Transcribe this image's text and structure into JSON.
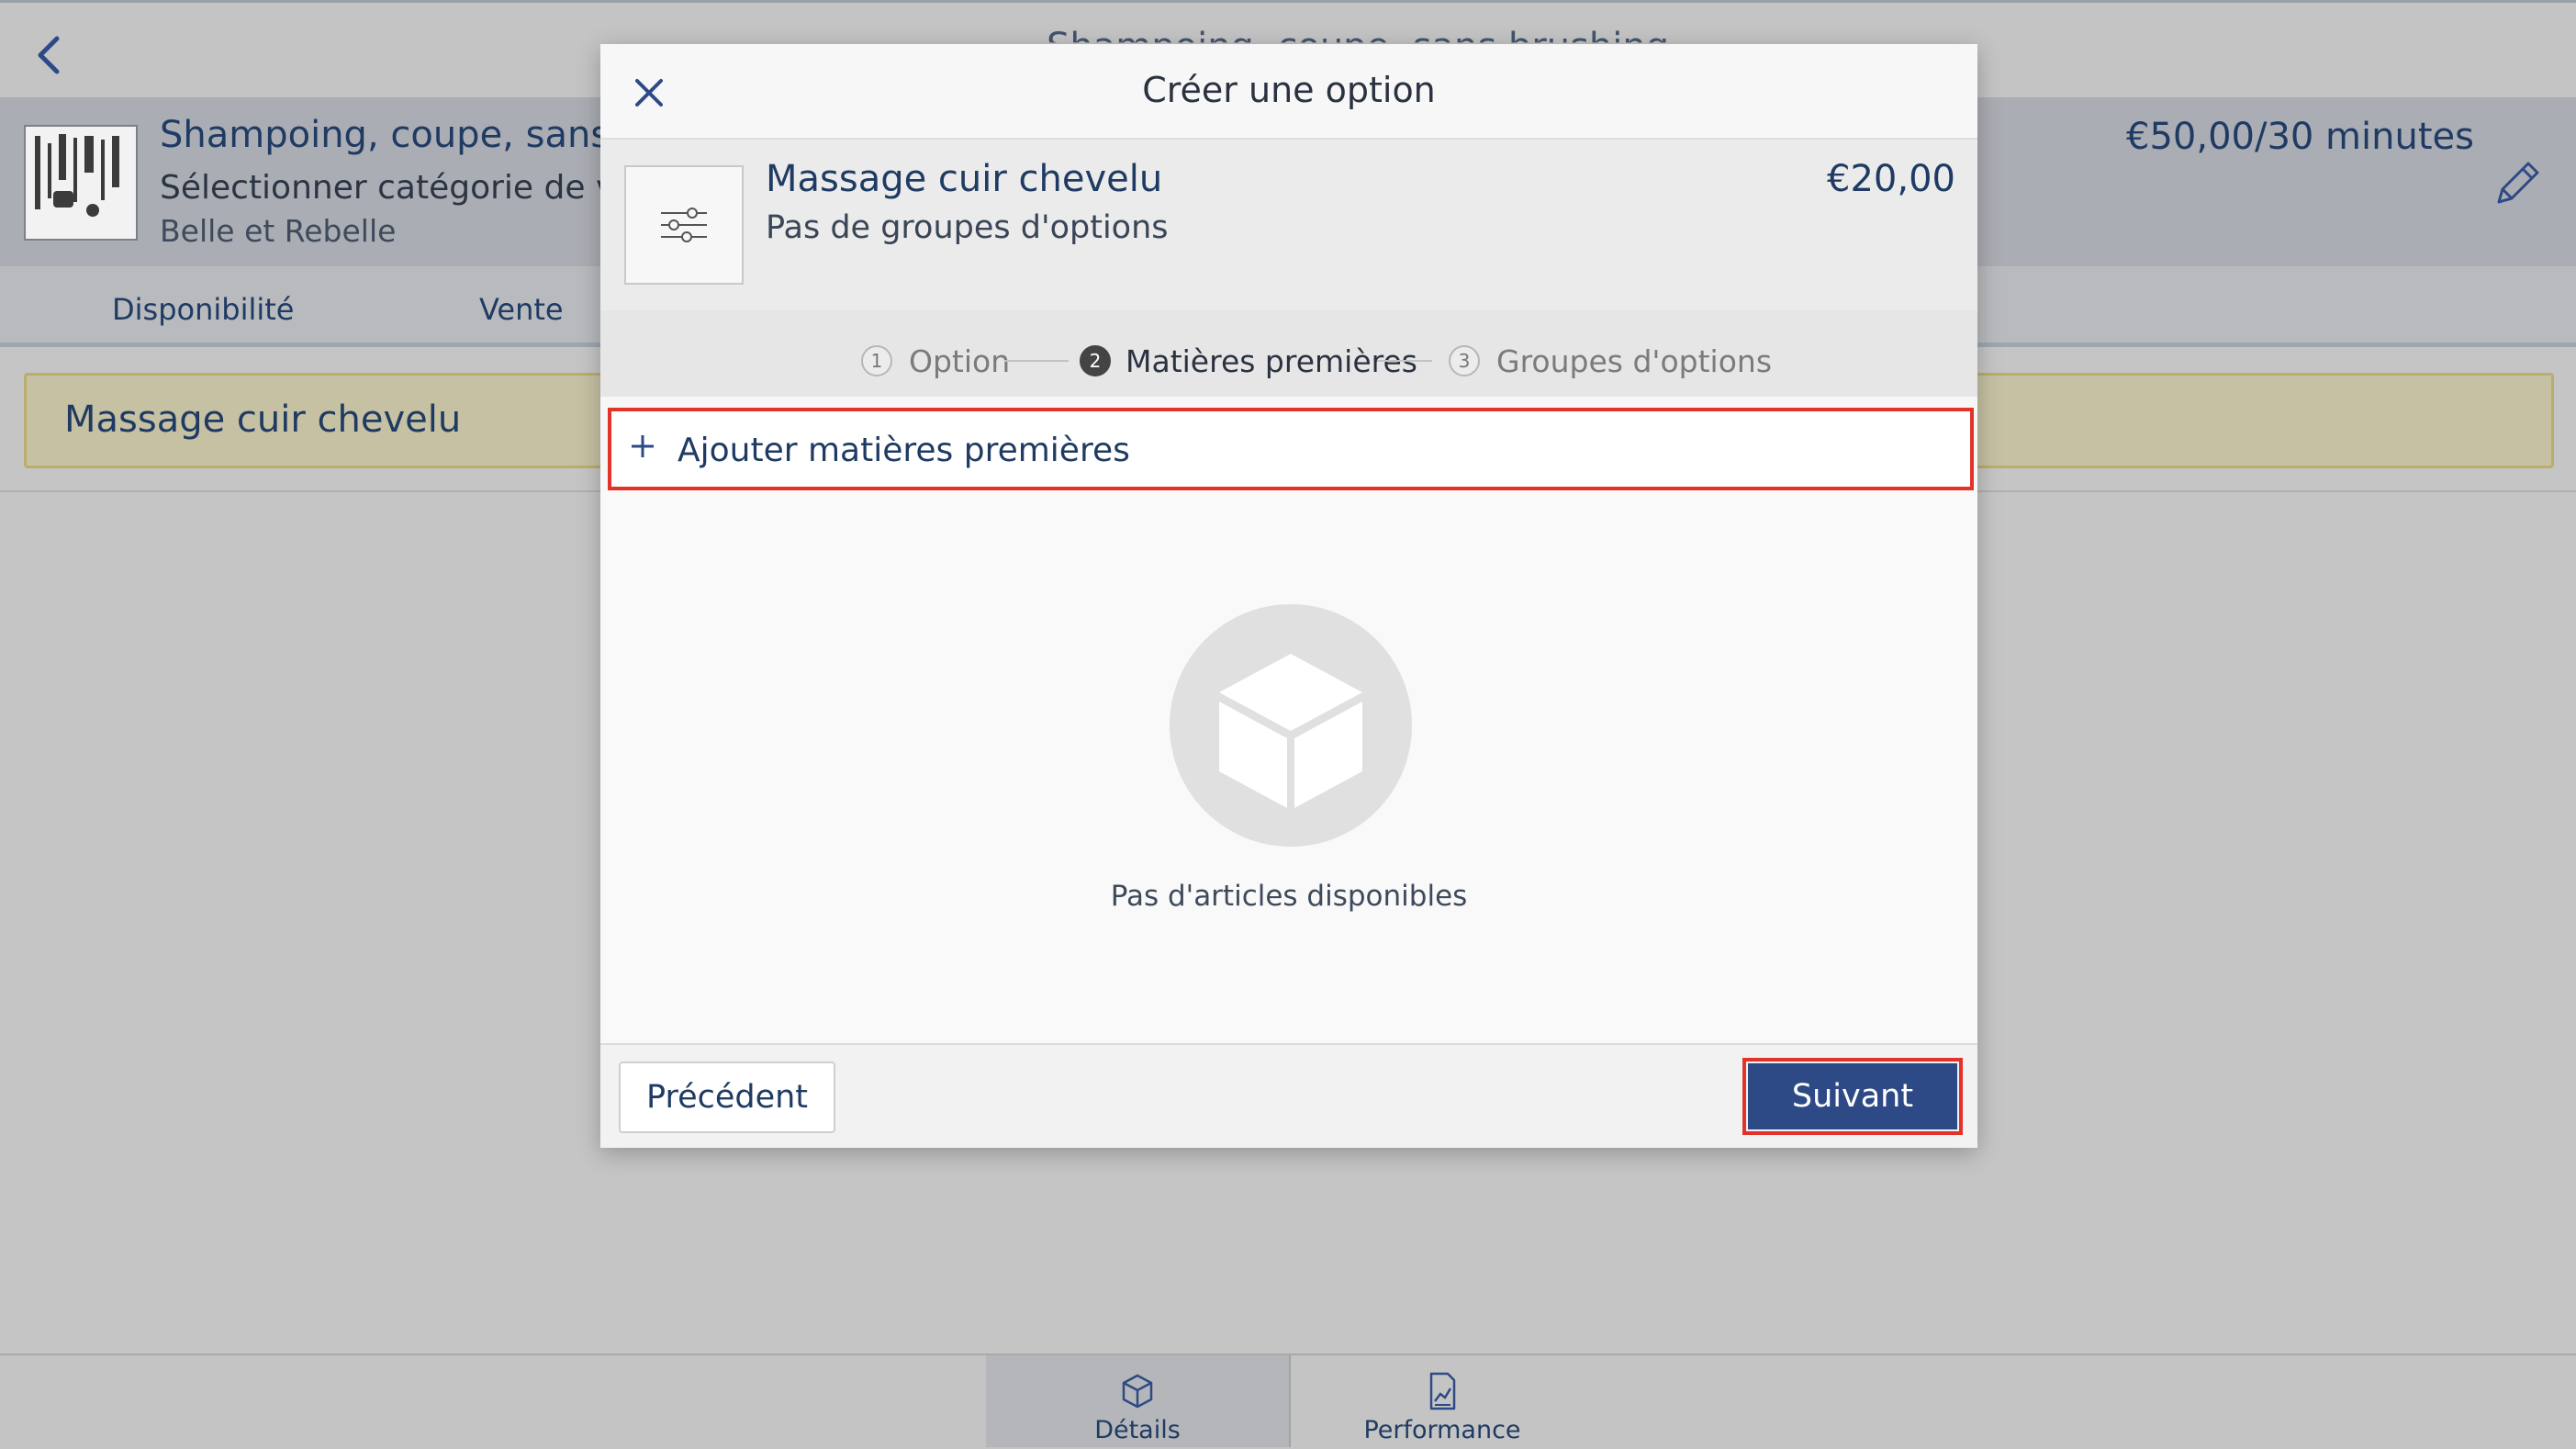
{
  "page": {
    "title_partial": "Shampoing, coupe, sans brushing"
  },
  "product": {
    "title": "Shampoing, coupe, sans bru",
    "sale_category": "Sélectionner catégorie de vente",
    "salon": "Belle et Rebelle",
    "price": "€50,00/30 minutes"
  },
  "tabs": [
    {
      "label": "Disponibilité"
    },
    {
      "label": "Vente"
    }
  ],
  "option_banner": {
    "label": "Massage cuir chevelu"
  },
  "bottom_nav": [
    {
      "label": "Détails",
      "icon": "box-icon",
      "active": true
    },
    {
      "label": "Performance",
      "icon": "chart-icon",
      "active": false
    }
  ],
  "modal": {
    "title": "Créer une option",
    "summary": {
      "name": "Massage cuir chevelu",
      "subtitle": "Pas de groupes d'options",
      "price": "€20,00",
      "icon": "sliders-icon"
    },
    "steps": [
      {
        "number": "1",
        "label": "Option",
        "active": false
      },
      {
        "number": "2",
        "label": "Matières premières",
        "active": true
      },
      {
        "number": "3",
        "label": "Groupes d'options",
        "active": false
      }
    ],
    "add_row_label": "Ajouter matières premières",
    "empty_state": {
      "icon": "cube-icon",
      "text": "Pas d'articles disponibles"
    },
    "footer": {
      "prev_label": "Précédent",
      "next_label": "Suivant"
    }
  },
  "colors": {
    "accent": "#2e4a86",
    "highlight": "#e2322a",
    "text_primary": "#1f3b63"
  }
}
